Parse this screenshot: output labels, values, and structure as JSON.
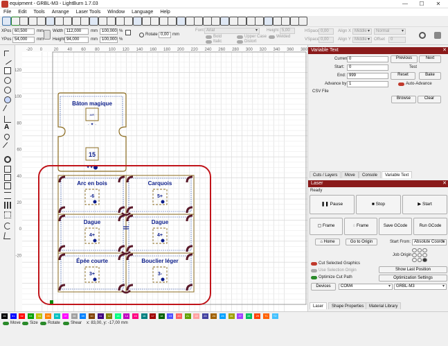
{
  "window": {
    "title": "equipment - GRBL-M3 - LightBurn 1.7.03",
    "minimize": "—",
    "maximize": "☐",
    "close": "✕"
  },
  "menu": [
    "File",
    "Edit",
    "Tools",
    "Arrange",
    "Laser Tools",
    "Window",
    "Language",
    "Help"
  ],
  "props": {
    "xpos_label": "XPos",
    "xpos": "60,500",
    "ypos_label": "YPos",
    "ypos": "54,000",
    "unit": "mm",
    "width_label": "Width",
    "width": "112,000",
    "height_label": "Height",
    "height": "94,000",
    "wpct": "100,000",
    "hpct": "100,000",
    "pct": "%",
    "rotate_label": "Rotate",
    "rotate": "0,00",
    "rotate_unit": "mm",
    "font_label": "Font",
    "font": "Arial",
    "fheight_label": "Height",
    "fheight": "5,00",
    "hspace_label": "HSpace",
    "hspace": "0,00",
    "vspace_label": "VSpace",
    "vspace": "0,00",
    "alignx_label": "Align X",
    "alignx": "Middle",
    "aligny_label": "Align Y",
    "aligny": "Middle",
    "normal": "Normal",
    "offset_label": "Offset",
    "offset": "0",
    "bold": "Bold",
    "italic": "Italic",
    "upper": "Upper Case",
    "distort": "Distort",
    "welded": "Welded"
  },
  "variable_text": {
    "title": "Variable Text",
    "current_label": "Current:",
    "current": "0",
    "start_label": "Start:",
    "start": "0",
    "end_label": "End:",
    "end": "999",
    "advance_label": "Advance by:",
    "advance": "1",
    "previous": "Previous",
    "next": "Next",
    "test": "Test",
    "reset": "Reset",
    "bake": "Bake",
    "auto_advance": "Auto-Advance",
    "csv_label": "CSV File",
    "browse": "Browse",
    "clear": "Clear"
  },
  "panel_tabs": [
    "Cuts / Layers",
    "Move",
    "Console",
    "Variable Text"
  ],
  "laser": {
    "title": "Laser",
    "status": "Ready",
    "pause": "Pause",
    "stop": "Stop",
    "start": "Start",
    "frame1": "Frame",
    "frame2": "Frame",
    "save_gcode": "Save GCode",
    "run_gcode": "Run GCode",
    "home": "Home",
    "go_origin": "Go to Origin",
    "start_from_label": "Start From:",
    "start_from": "Absolute Coords",
    "job_origin": "Job Origin",
    "cut_selected": "Cut Selected Graphics",
    "use_selection": "Use Selection Origin",
    "optimize_cut": "Optimize Cut Path",
    "show_last": "Show Last Position",
    "opt_settings": "Optimization Settings",
    "devices": "Devices",
    "port": "COM4",
    "device": "GRBL-M3"
  },
  "bottom_tabs": [
    "Laser",
    "Shape Properties",
    "Material Library"
  ],
  "ruler_x": [
    "-20",
    "0",
    "20",
    "40",
    "60",
    "80",
    "100",
    "120",
    "140",
    "160",
    "180",
    "200",
    "220",
    "240",
    "260",
    "280",
    "300",
    "320",
    "340",
    "360",
    "380",
    "400",
    "420",
    "440"
  ],
  "ruler_y": [
    "120",
    "100",
    "80",
    "60",
    "40",
    "20",
    "0",
    "-20"
  ],
  "designs": {
    "top": {
      "title": "Bâton magique",
      "num1": "AIR",
      "num2": "15"
    },
    "cells": [
      {
        "title": "Arc en bois",
        "num": "-6"
      },
      {
        "title": "Carquois",
        "num": "5+"
      },
      {
        "title": "Dague",
        "num": "4+"
      },
      {
        "title": "Dague",
        "num": "4+"
      },
      {
        "title": "Épée courte",
        "num": "3+"
      },
      {
        "title": "Bouclier léger",
        "num": "3-"
      }
    ]
  },
  "palette": [
    "00",
    "01",
    "02",
    "03",
    "04",
    "05",
    "06",
    "07",
    "08",
    "09",
    "10",
    "11",
    "12",
    "13",
    "14",
    "15",
    "16",
    "17",
    "18",
    "19",
    "20",
    "21",
    "22",
    "23",
    "24",
    "25",
    "26",
    "27",
    "28",
    "29",
    "T1",
    "T2"
  ],
  "palette_colors": [
    "#000000",
    "#0000ff",
    "#ff0000",
    "#00a000",
    "#c0c000",
    "#ff8000",
    "#00c0c0",
    "#ff00ff",
    "#a0a0a0",
    "#0080ff",
    "#804000",
    "#400080",
    "#808000",
    "#00ff80",
    "#c000c0",
    "#ff0080",
    "#008080",
    "#a00000",
    "#006000",
    "#5050ff",
    "#ff6060",
    "#60a000",
    "#ffa0a0",
    "#4040a0",
    "#a06000",
    "#00a0ff",
    "#a0a000",
    "#a040ff",
    "#00c060",
    "#ff4000",
    "#ff6000",
    "#40c0ff"
  ],
  "status": {
    "move": "Move",
    "size": "Size",
    "rotate": "Rotate",
    "shear": "Shear",
    "coords": "x: 83,00, y: -17,00 mm"
  }
}
